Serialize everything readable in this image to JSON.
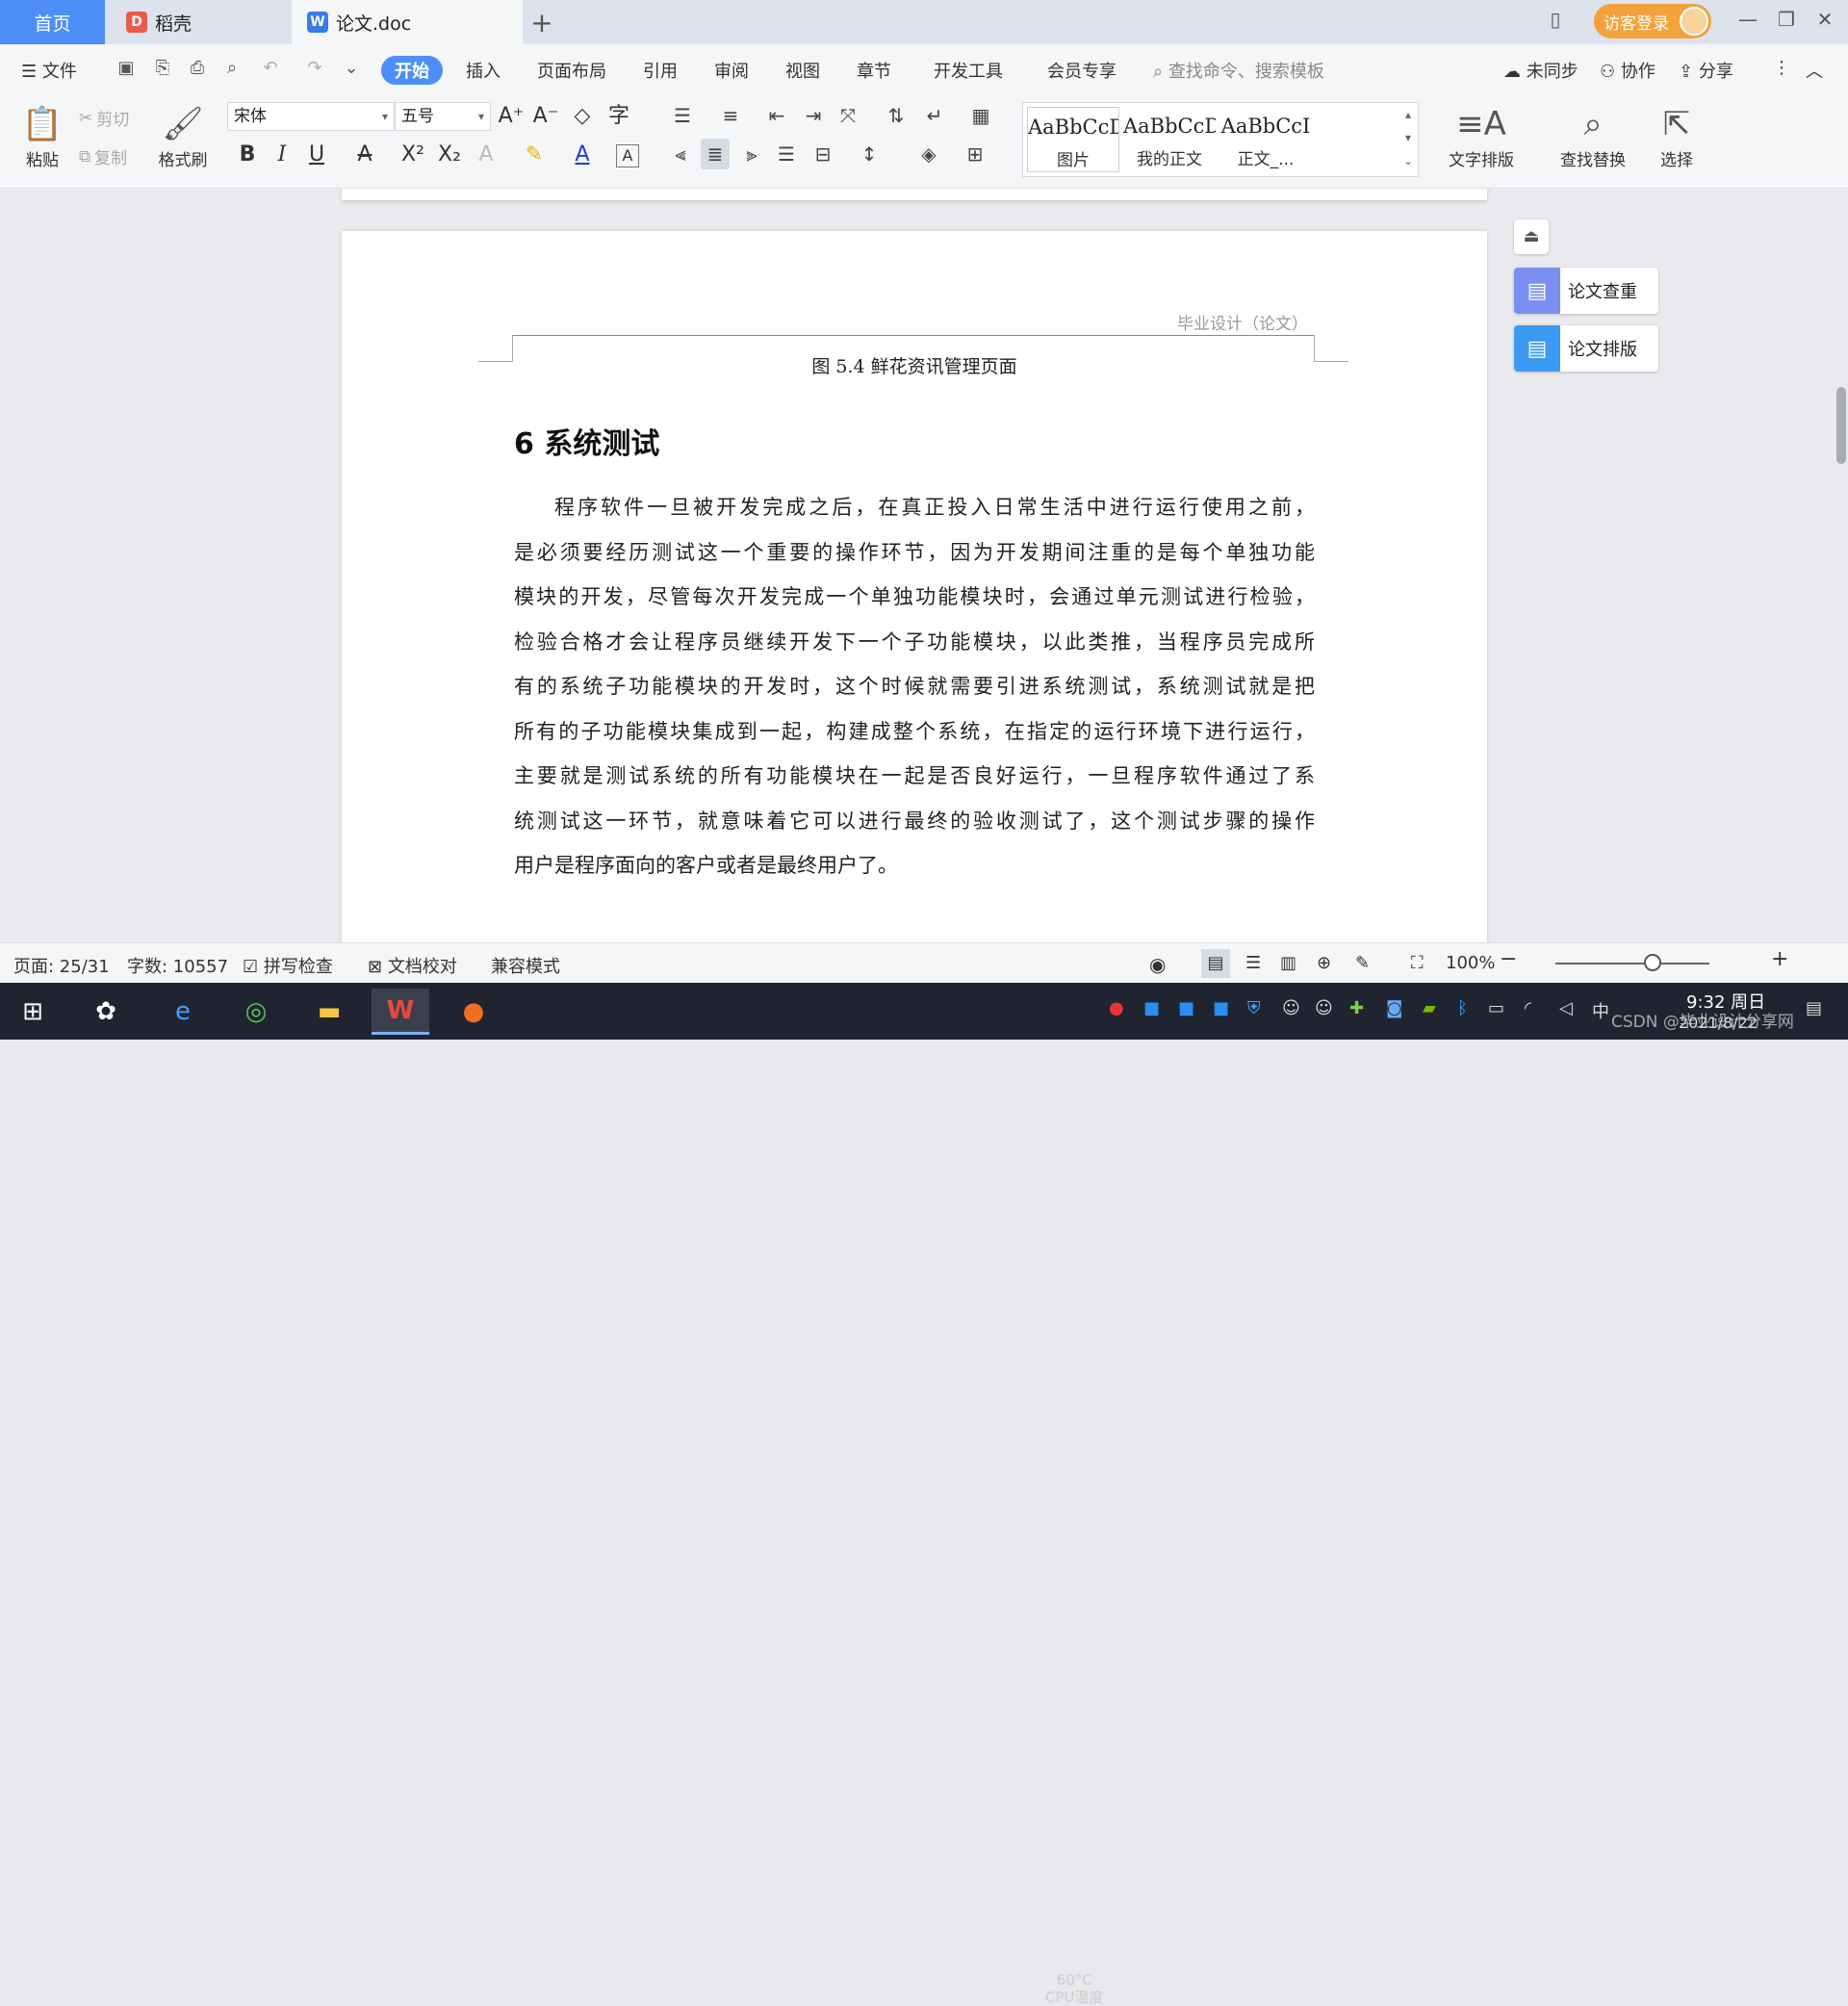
{
  "tabs": {
    "home": "首页",
    "daoke": "稻壳",
    "doc": "论文.doc",
    "add": "+"
  },
  "window": {
    "login": "访客登录",
    "minimize": "—",
    "restore": "❐",
    "close": "✕",
    "layout_icon": "▯"
  },
  "menu": {
    "file": "文件",
    "items": [
      "开始",
      "插入",
      "页面布局",
      "引用",
      "审阅",
      "视图",
      "章节",
      "开发工具",
      "会员专享"
    ],
    "search_placeholder": "查找命令、搜索模板",
    "sync": "未同步",
    "collab": "协作",
    "share": "分享"
  },
  "ribbon": {
    "paste": "粘贴",
    "cut": "剪切",
    "copy": "复制",
    "format_painter": "格式刷",
    "font_name": "宋体",
    "font_size": "五号",
    "styles": [
      {
        "sample": "AaBbCcDd",
        "name": "图片"
      },
      {
        "sample": "AaBbCcDd",
        "name": "我的正文"
      },
      {
        "sample": "AaBbCcI",
        "name": "正文_..."
      }
    ],
    "text_layout": "文字排版",
    "find_replace": "查找替换",
    "select": "选择"
  },
  "document": {
    "header": "毕业设计（论文）",
    "figure_caption": "图 5.4  鲜花资讯管理页面",
    "section_heading": "6  系统测试",
    "body_lines": [
      "程序软件一旦被开发完成之后，在真正投入日常生活中进行运行使用之前，",
      "是必须要经历测试这一个重要的操作环节，因为开发期间注重的是每个单独功能",
      "模块的开发，尽管每次开发完成一个单独功能模块时，会通过单元测试进行检验，",
      "检验合格才会让程序员继续开发下一个子功能模块，以此类推，当程序员完成所",
      "有的系统子功能模块的开发时，这个时候就需要引进系统测试，系统测试就是把",
      "所有的子功能模块集成到一起，构建成整个系统，在指定的运行环境下进行运行，",
      "主要就是测试系统的所有功能模块在一起是否良好运行，一旦程序软件通过了系",
      "统测试这一环节，就意味着它可以进行最终的验收测试了，这个测试步骤的操作",
      "用户是程序面向的客户或者是最终用户了。"
    ]
  },
  "side_panel": {
    "check": "论文查重",
    "layout": "论文排版"
  },
  "status": {
    "page": "页面: 25/31",
    "words": "字数: 10557",
    "spell": "拼写检查",
    "proof": "文档校对",
    "compat": "兼容模式",
    "zoom": "100%",
    "zoom_level_percent": 100
  },
  "taskbar": {
    "cpu_temp": "60°C",
    "cpu_label": "CPU温度",
    "ime": "中",
    "time": "9:32 周日",
    "date": "2021/8/22",
    "watermark": "CSDN @毕业设计分享网"
  },
  "colors": {
    "accent": "#4e8ef7",
    "login": "#f3a23b",
    "side_check": "#7b8ff0",
    "side_layout": "#3a9bf0"
  }
}
